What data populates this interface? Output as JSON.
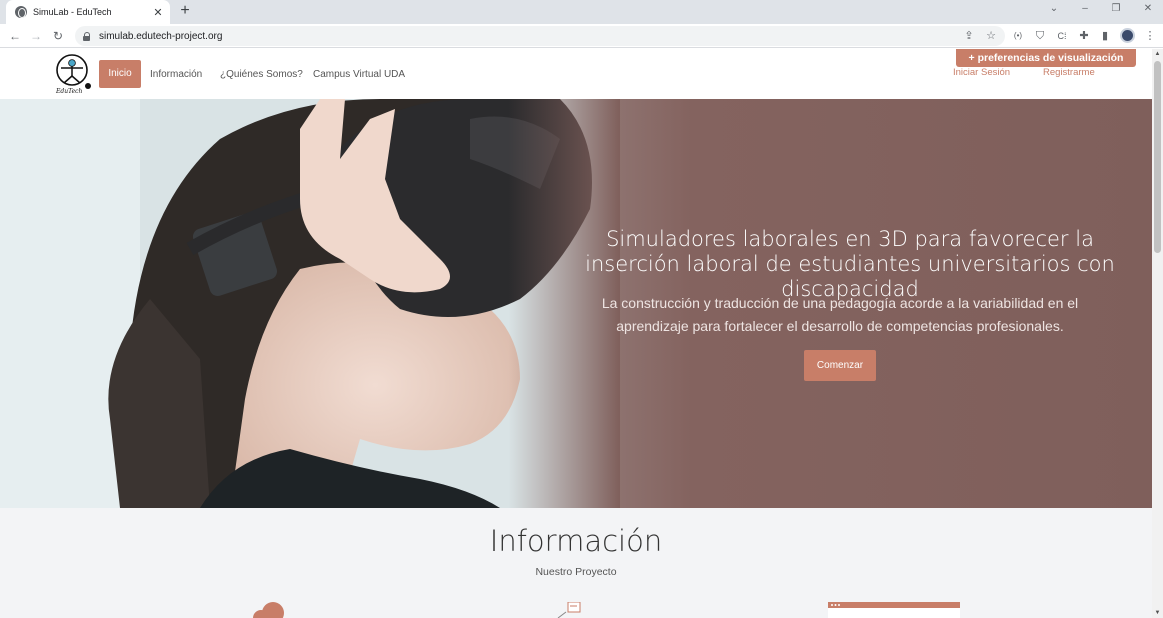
{
  "browser": {
    "tab_title": "SimuLab - EduTech",
    "tab_close": "✕",
    "new_tab": "+",
    "url": "simulab.edutech-project.org",
    "controls": {
      "minimize": "–",
      "maximize": "❐",
      "close": "✕",
      "tabsearch": "⌄"
    }
  },
  "header": {
    "logo_text": "EduTech",
    "nav": {
      "home": "Inicio",
      "info": "Información",
      "about": "¿Quiénes Somos?",
      "campus": "Campus Virtual UDA"
    },
    "prefs_button": "+ preferencias de visualización",
    "login": "Iniciar Sesión",
    "register": "Registrarme"
  },
  "hero": {
    "title": "Simuladores laborales en 3D para favorecer la inserción laboral de estudiantes universitarios con discapacidad",
    "subtitle": "La construcción y traducción de una pedagogía acorde a la variabilidad en el aprendizaje para fortalecer el desarrollo de competencias profesionales.",
    "cta": "Comenzar"
  },
  "info": {
    "title": "Información",
    "subtitle": "Nuestro Proyecto"
  },
  "colors": {
    "accent": "#c87e68",
    "hero_overlay": "#7f5f5b"
  }
}
